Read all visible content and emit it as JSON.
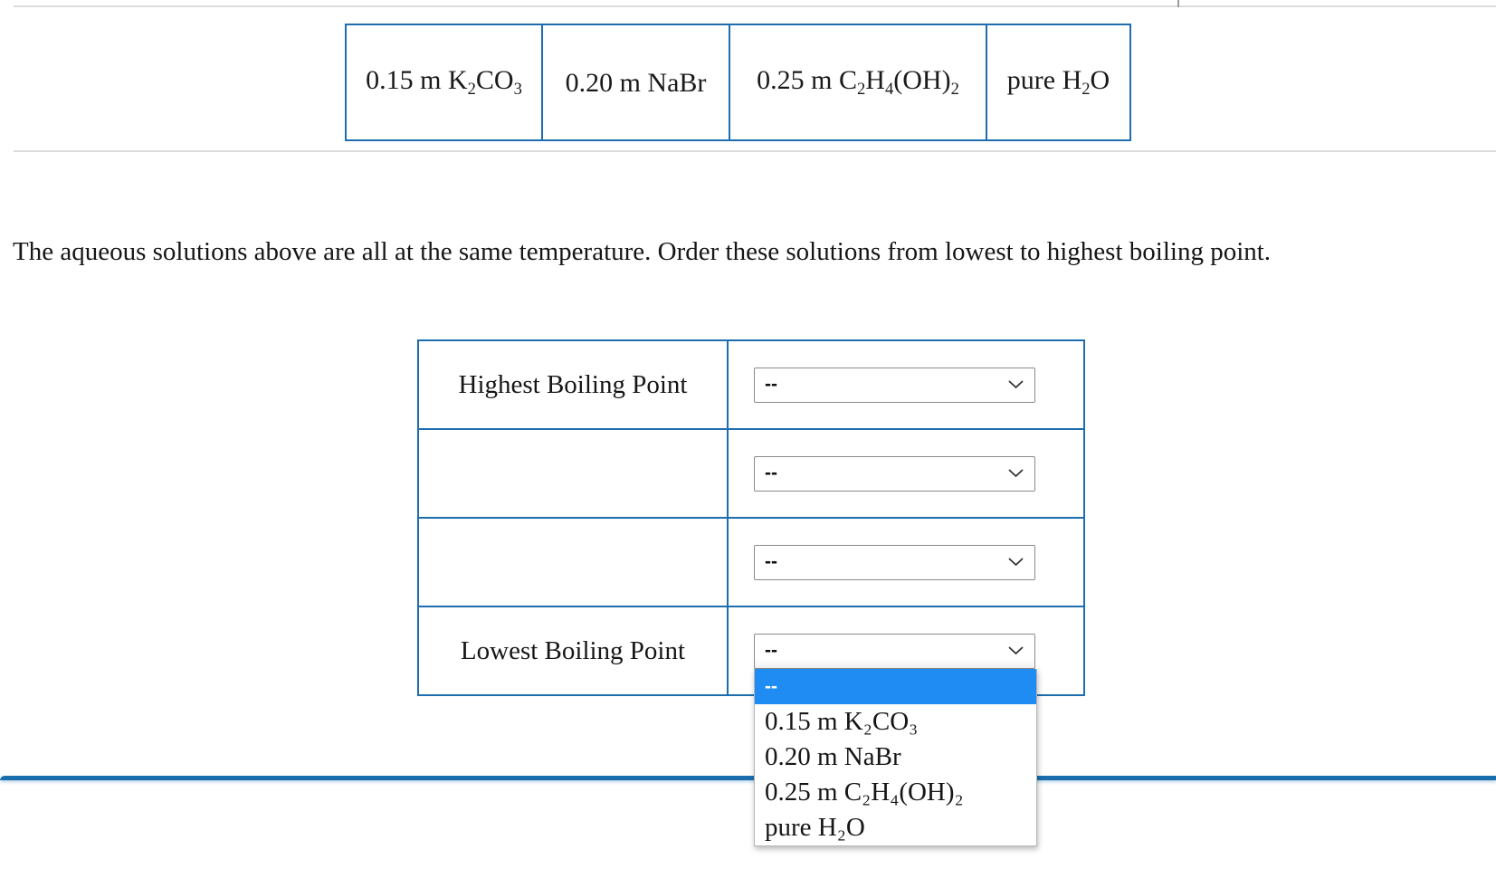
{
  "dividers": {
    "top_rule_color": "#dcdcdc",
    "bottom_rule_color": "#1a6eae",
    "table_border_color": "#1d6daf",
    "highlight_color": "#1f8cf4"
  },
  "choices_table": {
    "cells": [
      {
        "prefix": "0.15 m K",
        "sub1": "2",
        "mid": "CO",
        "sub2": "3",
        "suffix": ""
      },
      {
        "prefix": "0.20 m NaBr",
        "sub1": "",
        "mid": "",
        "sub2": "",
        "suffix": ""
      },
      {
        "prefix": "0.25 m C",
        "sub1": "2",
        "mid": "H",
        "sub2": "4",
        "suffix": "(OH)",
        "sub3": "2"
      },
      {
        "prefix": "pure H",
        "sub1": "2",
        "mid": "O",
        "sub2": "",
        "suffix": ""
      }
    ],
    "plain_labels": [
      "0.15 m K2CO3",
      "0.20 m NaBr",
      "0.25 m C2H4(OH)2",
      "pure H2O"
    ]
  },
  "prompt": {
    "text": "The aqueous solutions above are all at the same temperature. Order these solutions from lowest to highest boiling point."
  },
  "answer_table": {
    "rows": [
      {
        "label": "Highest Boiling Point",
        "selected": "--"
      },
      {
        "label": "",
        "selected": "--"
      },
      {
        "label": "",
        "selected": "--"
      },
      {
        "label": "Lowest Boiling Point",
        "selected": "--"
      }
    ]
  },
  "dropdown": {
    "open_for_row": 4,
    "options": [
      {
        "label": "--",
        "highlighted": true
      },
      {
        "label": "0.15 m K₂CO₃",
        "highlighted": false
      },
      {
        "label": "0.20 m NaBr",
        "highlighted": false
      },
      {
        "label": "0.25 m C₂H₄(OH)₂",
        "highlighted": false
      },
      {
        "label": "pure H₂O",
        "highlighted": false
      }
    ]
  },
  "icons": {
    "chevron_down": "chevron-down-icon"
  }
}
